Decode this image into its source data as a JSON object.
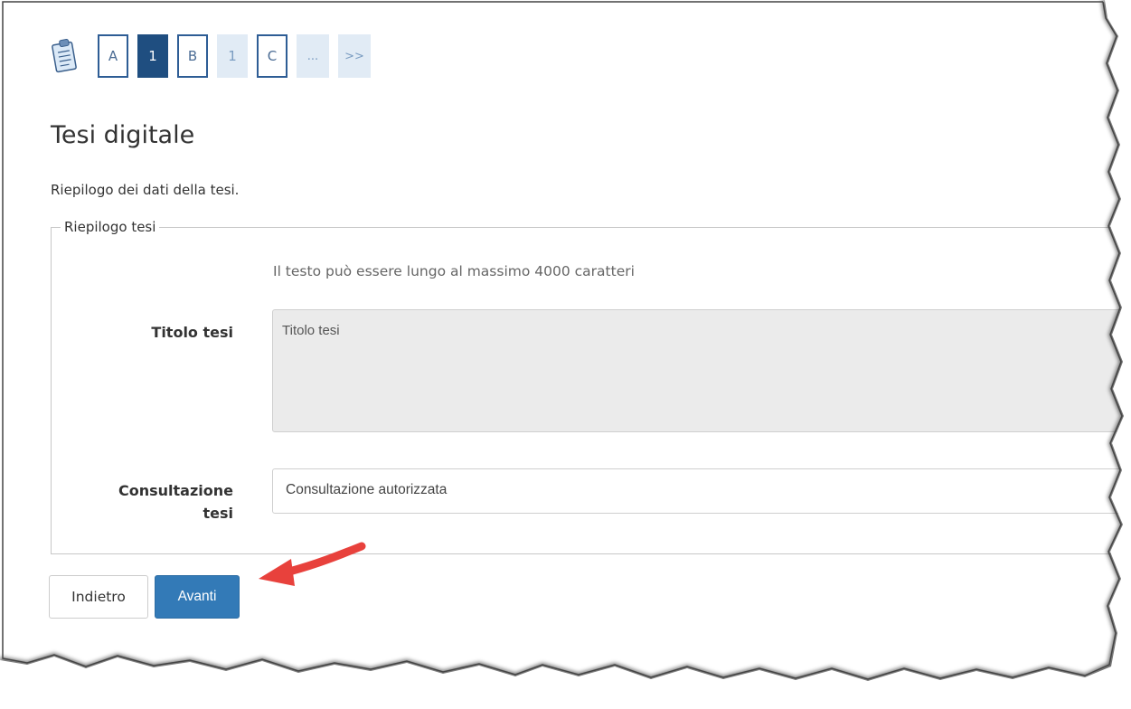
{
  "steps": [
    {
      "label": "A",
      "kind": "letter"
    },
    {
      "label": "1",
      "kind": "active"
    },
    {
      "label": "B",
      "kind": "letter"
    },
    {
      "label": "1",
      "kind": "sub"
    },
    {
      "label": "C",
      "kind": "letter"
    },
    {
      "label": "...",
      "kind": "more"
    },
    {
      "label": ">>",
      "kind": "more"
    }
  ],
  "page": {
    "title": "Tesi digitale",
    "intro": "Riepilogo dei dati della tesi."
  },
  "summary": {
    "legend": "Riepilogo tesi",
    "hint": "Il testo può essere lungo al massimo 4000 caratteri",
    "title_label": "Titolo tesi",
    "title_value": "Titolo tesi",
    "consult_label_line1": "Consultazione",
    "consult_label_line2": "tesi",
    "consult_value": "Consultazione autorizzata"
  },
  "buttons": {
    "back": "Indietro",
    "next": "Avanti"
  },
  "colors": {
    "accent": "#337ab7",
    "step_active": "#1f4e80",
    "annotation_arrow": "#e8413c"
  },
  "icons": {
    "steps_icon": "clipboard-checklist-icon",
    "annotation": "red-arrow-icon"
  }
}
